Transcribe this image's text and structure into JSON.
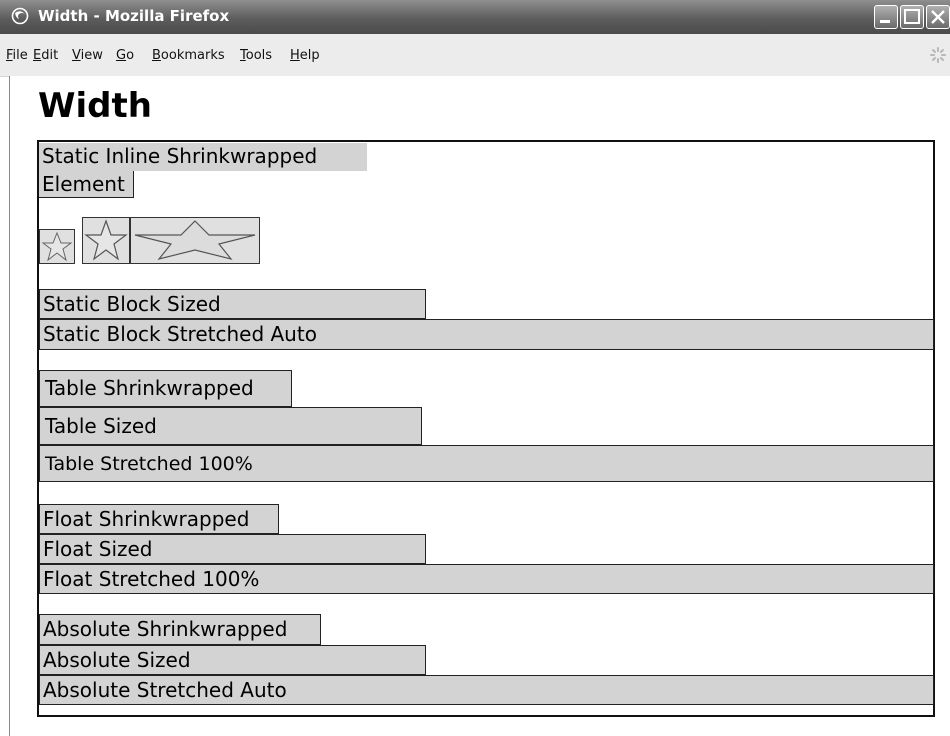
{
  "window": {
    "title": "Width - Mozilla Firefox",
    "icon": "firefox-icon",
    "controls": [
      "minimize-icon",
      "maximize-icon",
      "close-icon"
    ]
  },
  "menu": {
    "items": [
      {
        "label": "File",
        "accel": "F"
      },
      {
        "label": "Edit",
        "accel": "E"
      },
      {
        "label": "View",
        "accel": "V"
      },
      {
        "label": "Go",
        "accel": "G"
      },
      {
        "label": "Bookmarks",
        "accel": "B"
      },
      {
        "label": "Tools",
        "accel": "T"
      },
      {
        "label": "Help",
        "accel": "H"
      }
    ]
  },
  "page": {
    "heading": "Width",
    "inline": {
      "line1": "Static Inline Shrinkwrapped",
      "line2": "Element"
    },
    "images": [
      "star-icon",
      "star-icon",
      "star-icon"
    ],
    "static_block_sized": "Static Block Sized",
    "static_block_stretched": "Static Block Stretched Auto",
    "table_shrinkwrapped": "Table Shrinkwrapped",
    "table_sized": "Table Sized",
    "table_stretched": "Table Stretched 100%",
    "float_shrinkwrapped": "Float Shrinkwrapped",
    "float_sized": "Float Sized",
    "float_stretched": "Float Stretched 100%",
    "absolute_shrinkwrapped": "Absolute Shrinkwrapped",
    "absolute_sized": "Absolute Sized",
    "absolute_stretched": "Absolute Stretched Auto"
  },
  "colors": {
    "box_fill": "#d3d3d3",
    "border": "#222222",
    "titlebar": "#5d5d5d"
  }
}
